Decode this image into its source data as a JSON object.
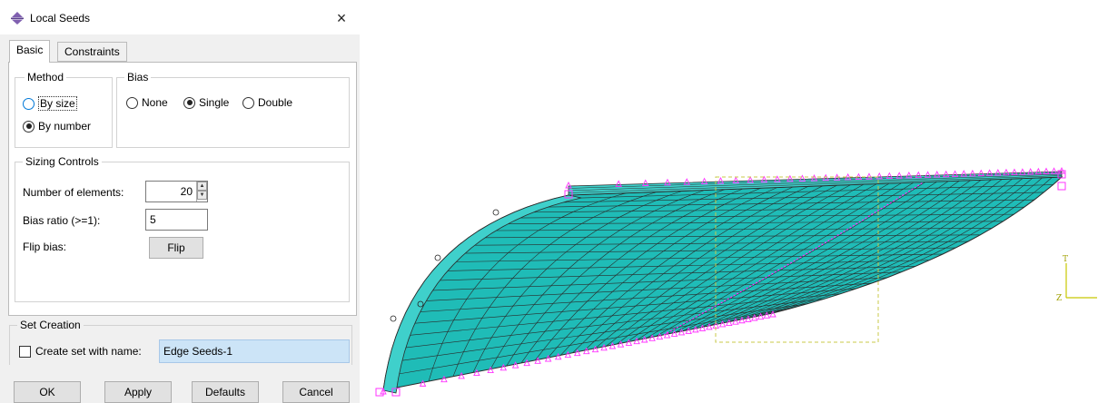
{
  "window": {
    "title": "Local Seeds",
    "close_glyph": "×",
    "icon": "abaqus-seed-icon"
  },
  "tabs": [
    {
      "label": "Basic",
      "active": true
    },
    {
      "label": "Constraints",
      "active": false
    }
  ],
  "method": {
    "legend": "Method",
    "options": [
      {
        "label": "By size",
        "selected": false
      },
      {
        "label": "By number",
        "selected": true
      }
    ]
  },
  "bias": {
    "legend": "Bias",
    "options": [
      {
        "label": "None",
        "selected": false
      },
      {
        "label": "Single",
        "selected": true
      },
      {
        "label": "Double",
        "selected": false
      }
    ]
  },
  "sizing": {
    "legend": "Sizing Controls",
    "num_elements_label": "Number of elements:",
    "num_elements_value": "20",
    "bias_ratio_label": "Bias ratio (>=1):",
    "bias_ratio_value": "5",
    "flip_bias_label": "Flip bias:",
    "flip_button": "Flip"
  },
  "set_creation": {
    "legend": "Set Creation",
    "checkbox_label": "Create set with name:",
    "checked": false,
    "name_value": "Edge Seeds-1"
  },
  "buttons": {
    "ok": "OK",
    "apply": "Apply",
    "defaults": "Defaults",
    "cancel": "Cancel"
  },
  "viewport": {
    "triad_labels": {
      "vertical": "T",
      "horizontal": "Z"
    },
    "colors": {
      "mesh": "#1fbcb7",
      "edge": "#2a2a2a",
      "seed": "#ff33ff",
      "highlight": "#c8c84a",
      "triad": "#c8c800"
    }
  }
}
